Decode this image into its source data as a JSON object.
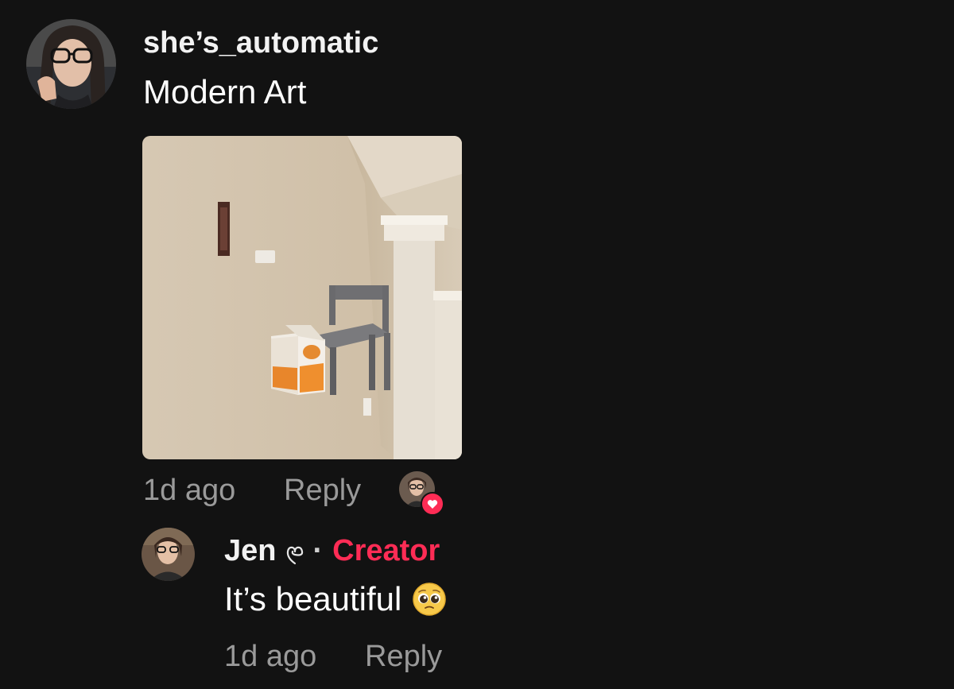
{
  "comment": {
    "username": "she’s_automatic",
    "text": "Modern Art",
    "time": "1d ago",
    "reply_label": "Reply",
    "liked_by_creator": true
  },
  "reply": {
    "username": "Jen",
    "separator": "·",
    "badge": "Creator",
    "text": "It’s beautiful",
    "emoji": "🥹",
    "time": "1d ago",
    "reply_label": "Reply"
  },
  "colors": {
    "background": "#121212",
    "creator_accent": "#fe2c55",
    "meta_text": "#9a9a9a"
  },
  "icons": {
    "username_suffix": "heart-outline-icon",
    "liked_badge": "heart-icon"
  }
}
